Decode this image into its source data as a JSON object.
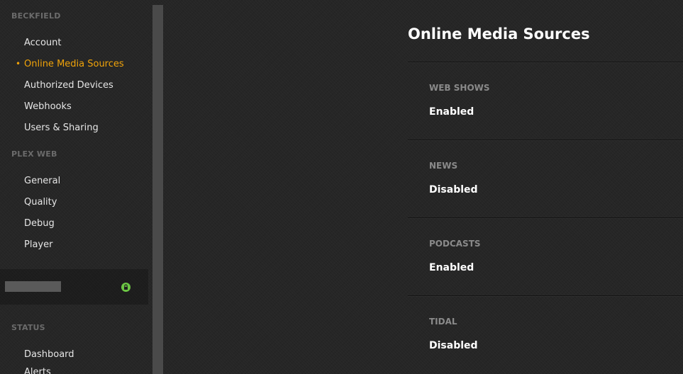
{
  "sidebar": {
    "sections": [
      {
        "header": "BECKFIELD",
        "items": [
          {
            "label": "Account"
          },
          {
            "label": "Online Media Sources"
          },
          {
            "label": "Authorized Devices"
          },
          {
            "label": "Webhooks"
          },
          {
            "label": "Users & Sharing"
          }
        ]
      },
      {
        "header": "PLEX WEB",
        "items": [
          {
            "label": "General"
          },
          {
            "label": "Quality"
          },
          {
            "label": "Debug"
          },
          {
            "label": "Player"
          }
        ]
      },
      {
        "header": "STATUS",
        "items": [
          {
            "label": "Dashboard"
          },
          {
            "label": "Alerts"
          }
        ]
      }
    ],
    "active_item": "Online Media Sources",
    "server": {
      "lock_icon": "lock-icon",
      "lock_color": "#6cc644"
    },
    "bullet": "•"
  },
  "main": {
    "title": "Online Media Sources",
    "sources": [
      {
        "label": "WEB SHOWS",
        "value": "Enabled"
      },
      {
        "label": "NEWS",
        "value": "Disabled"
      },
      {
        "label": "PODCASTS",
        "value": "Enabled"
      },
      {
        "label": "TIDAL",
        "value": "Disabled"
      }
    ]
  },
  "colors": {
    "accent": "#f0a30a",
    "background": "#262626",
    "muted_header": "#6b6b6b"
  }
}
